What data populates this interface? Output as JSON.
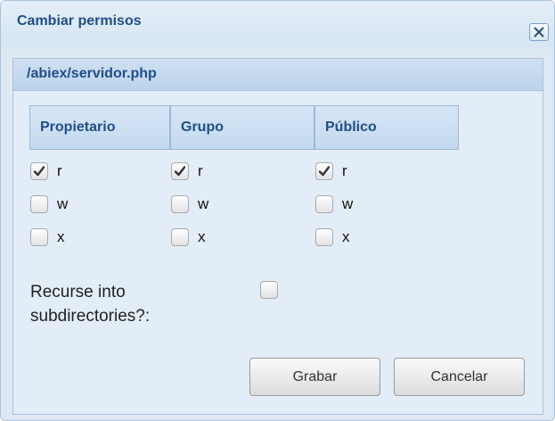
{
  "dialog": {
    "title": "Cambiar permisos",
    "close_icon": "close-x-icon",
    "path": "/abiex/servidor.php",
    "columns": [
      "Propietario",
      "Grupo",
      "Público"
    ],
    "permissions": [
      {
        "label": "r",
        "values": [
          true,
          true,
          true
        ]
      },
      {
        "label": "w",
        "values": [
          false,
          false,
          false
        ]
      },
      {
        "label": "x",
        "values": [
          false,
          false,
          false
        ]
      }
    ],
    "recurse": {
      "label": "Recurse into subdirectories?:",
      "checked": false
    },
    "buttons": {
      "save": "Grabar",
      "cancel": "Cancelar"
    }
  },
  "colors": {
    "title_text": "#1f4e8a",
    "dialog_bg": "#dfe9f4",
    "border": "#a9c3dc"
  }
}
